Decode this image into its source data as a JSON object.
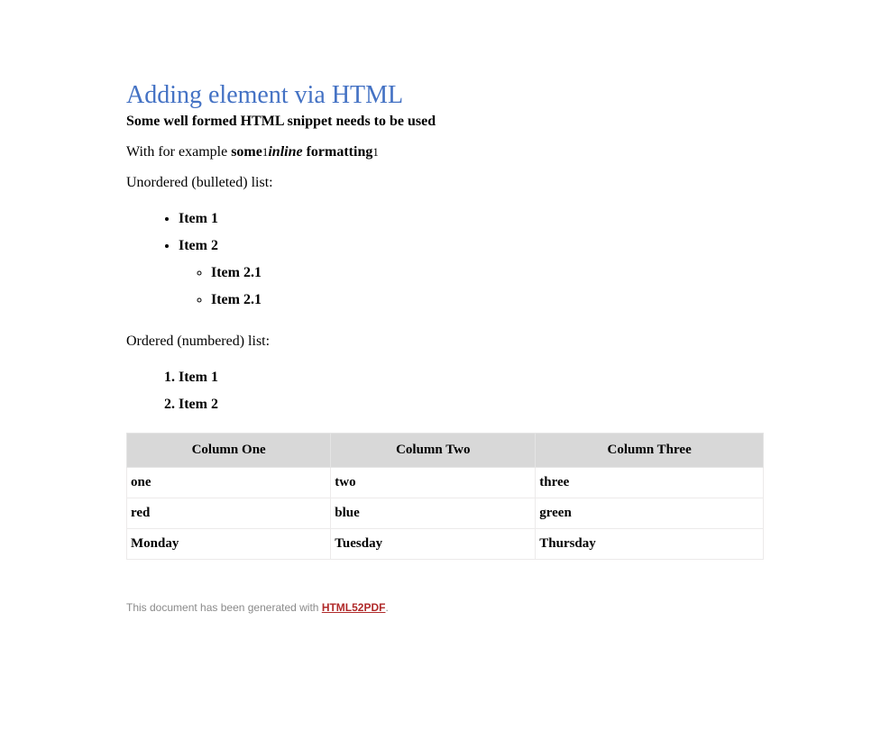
{
  "title": "Adding element via HTML",
  "lead": "Some well formed HTML snippet needs to be used",
  "inline": {
    "prefix": "With for example ",
    "bold1": "some",
    "small1": "1",
    "italic": "inline",
    "bold2": " formatting",
    "small2": "1"
  },
  "unordered_label": "Unordered (bulleted) list:",
  "ul": {
    "item1": "Item 1",
    "item2": "Item 2",
    "sub1": "Item 2.1",
    "sub2": "Item 2.1"
  },
  "ordered_label": "Ordered (numbered) list:",
  "ol": {
    "item1": "Item 1",
    "item2": "Item 2"
  },
  "table": {
    "headers": [
      "Column One",
      "Column Two",
      "Column Three"
    ],
    "rows": [
      [
        "one",
        "two",
        "three"
      ],
      [
        "red",
        "blue",
        "green"
      ],
      [
        "Monday",
        "Tuesday",
        "Thursday"
      ]
    ]
  },
  "footer": {
    "text": "This document has been generated with ",
    "link": "HTML52PDF",
    "suffix": "."
  }
}
